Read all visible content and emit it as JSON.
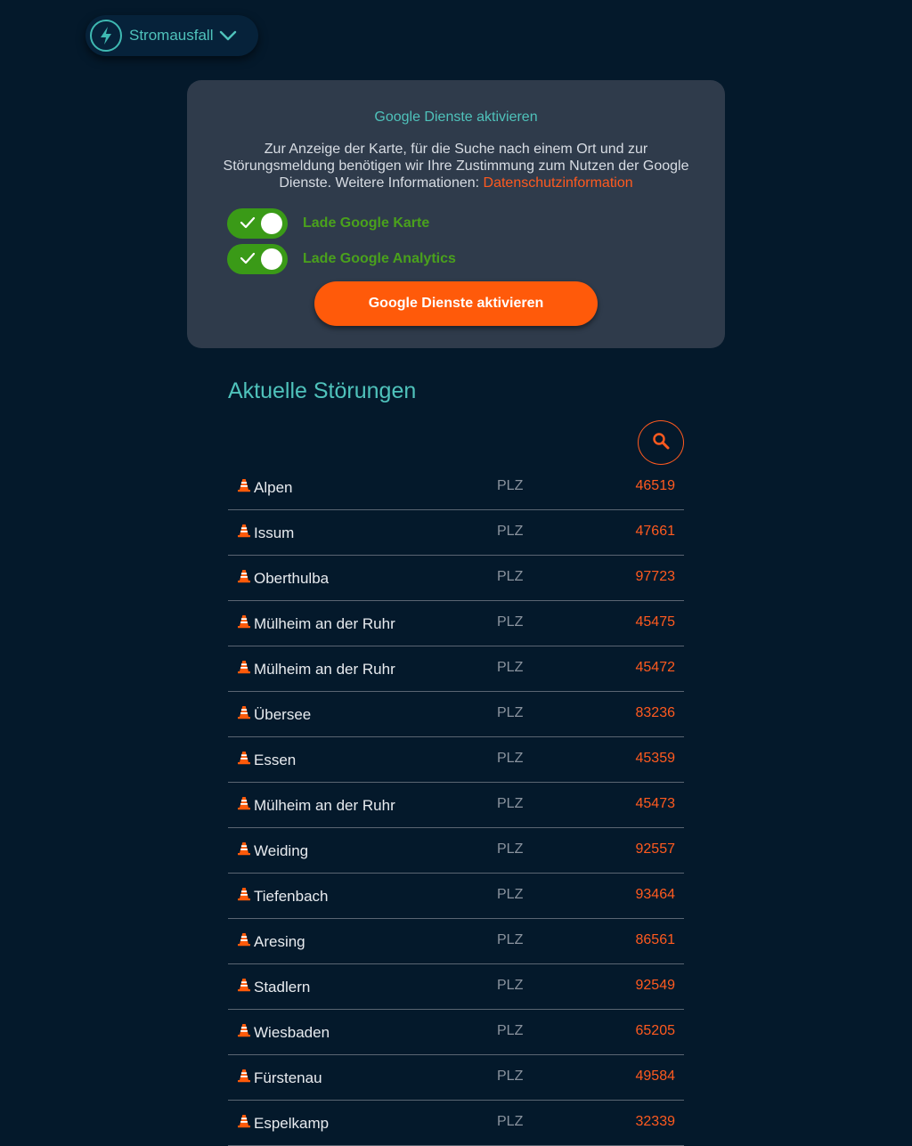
{
  "header": {
    "category_label": "Stromausfall",
    "icons": [
      "bolt-icon",
      "chevron-down-icon"
    ]
  },
  "consent": {
    "title": "Google Dienste aktivieren",
    "text": "Zur Anzeige der Karte, für die Suche nach einem Ort und zur Störungsmeldung benötigen wir Ihre Zustimmung zum Nutzen der Google Dienste. Weitere Informationen:",
    "link_text": "Datenschutzinformation",
    "toggles": [
      {
        "label": "Lade Google Karte",
        "on": true
      },
      {
        "label": "Lade Google Analytics",
        "on": true
      }
    ],
    "button_label": "Google Dienste aktivieren"
  },
  "outages": {
    "title": "Aktuelle Störungen",
    "search_icon": "search-icon",
    "row_icon": "traffic-cone-icon",
    "plz_label": "PLZ",
    "rows": [
      {
        "city": "Alpen",
        "zip": "46519"
      },
      {
        "city": "Issum",
        "zip": "47661"
      },
      {
        "city": "Oberthulba",
        "zip": "97723"
      },
      {
        "city": "Mülheim an der Ruhr",
        "zip": "45475"
      },
      {
        "city": "Mülheim an der Ruhr",
        "zip": "45472"
      },
      {
        "city": "Übersee",
        "zip": "83236"
      },
      {
        "city": "Essen",
        "zip": "45359"
      },
      {
        "city": "Mülheim an der Ruhr",
        "zip": "45473"
      },
      {
        "city": "Weiding",
        "zip": "92557"
      },
      {
        "city": "Tiefenbach",
        "zip": "93464"
      },
      {
        "city": "Aresing",
        "zip": "86561"
      },
      {
        "city": "Stadlern",
        "zip": "92549"
      },
      {
        "city": "Wiesbaden",
        "zip": "65205"
      },
      {
        "city": "Fürstenau",
        "zip": "49584"
      },
      {
        "city": "Espelkamp",
        "zip": "32339"
      }
    ]
  },
  "colors": {
    "background": "#04192b",
    "accent_teal": "#4fc2bb",
    "accent_orange": "#ff5a1f",
    "toggle_green": "#3a9a17"
  }
}
